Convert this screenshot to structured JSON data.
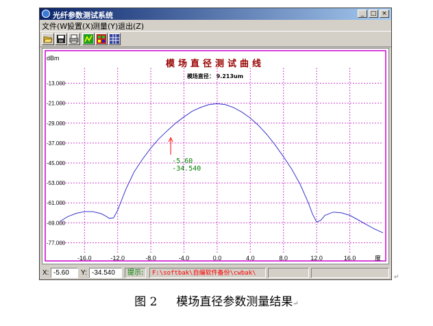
{
  "window": {
    "title": "光纤参数测试系统",
    "btn_min": "_",
    "btn_max": "□",
    "btn_close": "×"
  },
  "menu": [
    {
      "label": "文件(W)"
    },
    {
      "label": "设置(X)"
    },
    {
      "label": "测量(Y)"
    },
    {
      "label": "退出(Z)"
    }
  ],
  "toolbar": {
    "icons": [
      "open-folder-icon",
      "save-disk-icon",
      "print-icon",
      "measure-green-icon",
      "measure-red-icon",
      "data-grid-icon"
    ]
  },
  "chart_data": {
    "type": "line",
    "title": "模场直径测试曲线",
    "subtitle": "模场直径： 9.213um",
    "ylabel": "dBm",
    "xlabel": "度",
    "xlim": [
      -19,
      20
    ],
    "ylim": [
      -81,
      -9
    ],
    "xticks": [
      -16.0,
      -12.0,
      -8.0,
      -4.0,
      0.0,
      4.0,
      8.0,
      12.0,
      16.0
    ],
    "xtick_labels": [
      "-16.0",
      "-12.0",
      "-8.0",
      "-4.0",
      "0.0",
      "4.0",
      "8.0",
      "12.0",
      "16.0"
    ],
    "yticks": [
      -13,
      -21,
      -29,
      -37,
      -45,
      -53,
      -61,
      -69,
      -77
    ],
    "ytick_labels": [
      "-13.000",
      "-21.000",
      "-29.000",
      "-37.000",
      "-45.000",
      "-53.000",
      "-61.000",
      "-69.000",
      "-77.000"
    ],
    "grid": true,
    "series": [
      {
        "color": "#3333cc",
        "x": [
          -19.0,
          -18.0,
          -17.0,
          -16.0,
          -15.0,
          -14.0,
          -13.5,
          -13.0,
          -12.5,
          -12.0,
          -11.0,
          -10.0,
          -9.0,
          -8.0,
          -7.0,
          -6.0,
          -5.0,
          -4.0,
          -3.0,
          -2.0,
          -1.0,
          0.0,
          1.0,
          2.0,
          3.0,
          4.0,
          5.0,
          6.0,
          7.0,
          8.0,
          9.0,
          10.0,
          11.0,
          11.5,
          12.0,
          12.5,
          13.0,
          14.0,
          15.0,
          16.0,
          17.0,
          18.0,
          19.0,
          20.0
        ],
        "y": [
          -68.5,
          -66.5,
          -65.2,
          -64.5,
          -64.5,
          -65.3,
          -66.2,
          -67.2,
          -67.0,
          -64.0,
          -55.5,
          -48.5,
          -43.5,
          -39.0,
          -35.2,
          -32.0,
          -29.0,
          -26.5,
          -24.2,
          -22.7,
          -21.6,
          -21.2,
          -21.6,
          -22.8,
          -24.6,
          -27.0,
          -30.0,
          -33.6,
          -37.8,
          -42.5,
          -47.5,
          -53.5,
          -61.0,
          -65.5,
          -68.7,
          -68.0,
          -66.0,
          -64.7,
          -65.0,
          -66.0,
          -67.8,
          -69.7,
          -71.5,
          -73.0
        ]
      }
    ],
    "annotation": {
      "x": -5.6,
      "y": -34.54,
      "label_x": "-5.60",
      "label_y": "-34.540",
      "color": "#008000",
      "arrow_color": "#ff0000"
    }
  },
  "status": {
    "x_label": "X:",
    "x_value": "-5.60",
    "y_label": "Y:",
    "y_value": "-34.540",
    "hint_label": "提示:",
    "hint_path": "F:\\softbak\\自编软件备份\\cwbak\\"
  },
  "caption": {
    "figure_number": "图 2",
    "text": "模场直径参数测量结果"
  }
}
